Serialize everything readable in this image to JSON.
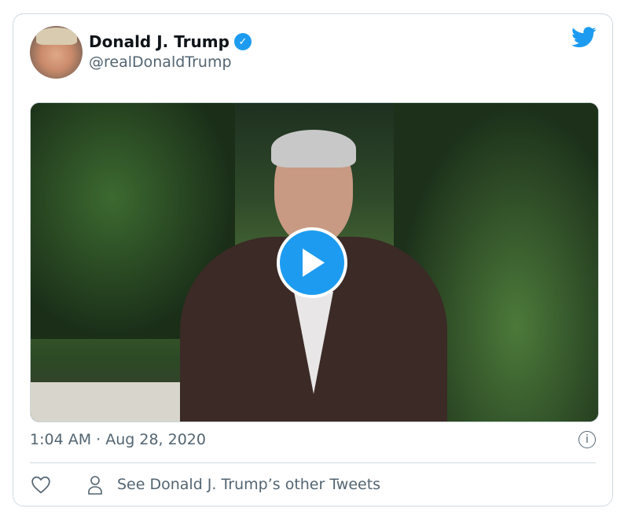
{
  "author": {
    "name": "Donald J. Trump",
    "handle": "@realDonaldTrump",
    "verified": true
  },
  "timestamp": "1:04 AM · Aug 28, 2020",
  "actions": {
    "see_other": "See Donald J. Trump’s other Tweets"
  },
  "icons": {
    "logo": "twitter-bird-icon",
    "play": "play-icon",
    "info": "info-icon",
    "like": "heart-icon",
    "profile": "person-icon"
  },
  "colors": {
    "accent": "#1d9bf0",
    "text": "#0f1419",
    "secondary": "#536471",
    "border": "#cfd9de"
  }
}
